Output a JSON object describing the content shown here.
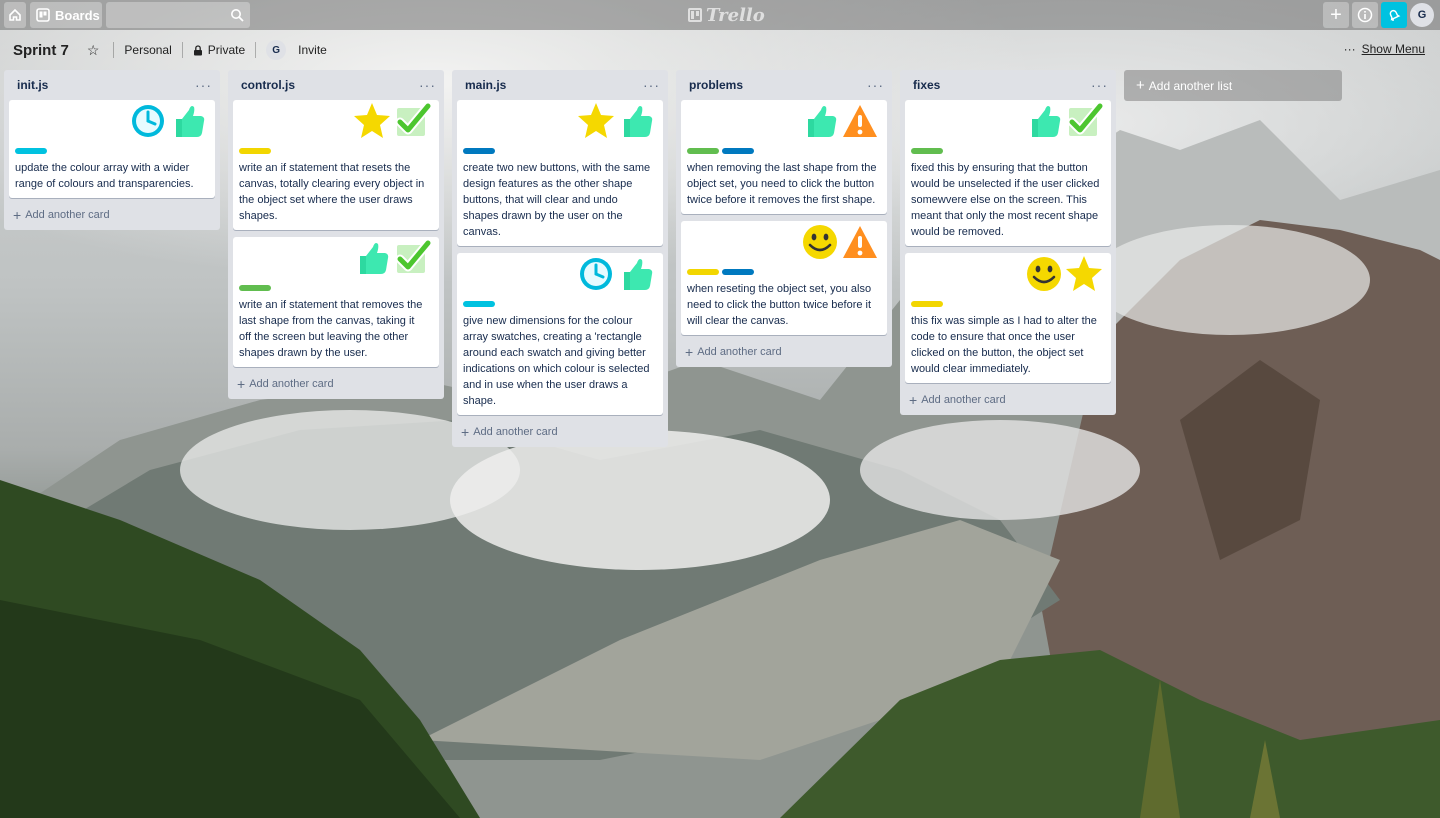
{
  "topbar": {
    "boards_label": "Boards",
    "search_value": "",
    "logo_text": "Trello",
    "avatar_initial": "G",
    "icons": {
      "home": "home-icon",
      "boards": "board-icon",
      "search": "search-icon",
      "add": "plus-icon",
      "info": "info-icon",
      "notifications": "bell-icon"
    }
  },
  "board": {
    "title": "Sprint 7",
    "team": "Personal",
    "visibility": "Private",
    "member_initial": "G",
    "invite": "Invite",
    "show_menu": "Show Menu",
    "add_list": "Add another list",
    "add_card": "Add another card",
    "list_menu": "···"
  },
  "colors": {
    "cyan": "#00c2e0",
    "yellow": "#f2d600",
    "green": "#61bd4f",
    "blue": "#0079bf"
  },
  "lists": [
    {
      "name": "init.js",
      "cards": [
        {
          "stickers": [
            "clock",
            "thumbsup"
          ],
          "labels": [
            "cyan"
          ],
          "text": "update the colour array with a wider range of colours and transparencies."
        }
      ]
    },
    {
      "name": "control.js",
      "cards": [
        {
          "stickers": [
            "star",
            "check"
          ],
          "labels": [
            "yellow"
          ],
          "text": "write an if statement that resets the canvas, totally clearing every object in the object set where the user draws shapes."
        },
        {
          "stickers": [
            "thumbsup",
            "check"
          ],
          "labels": [
            "green"
          ],
          "text": "write an if statement that removes the last shape from the canvas, taking it off the screen but leaving the other shapes drawn by the user."
        }
      ]
    },
    {
      "name": "main.js",
      "cards": [
        {
          "stickers": [
            "star",
            "thumbsup"
          ],
          "labels": [
            "blue"
          ],
          "text": "create two new buttons, with the same design features as the other shape buttons, that will clear and undo shapes drawn by the user on the canvas."
        },
        {
          "stickers": [
            "clock",
            "thumbsup"
          ],
          "labels": [
            "cyan"
          ],
          "text": "give new dimensions for the colour array swatches, creating a 'rectangle around each swatch and giving better indications on which colour is selected and in use when the user draws a shape."
        }
      ]
    },
    {
      "name": "problems",
      "cards": [
        {
          "stickers": [
            "thumbsup",
            "warning"
          ],
          "labels": [
            "green",
            "blue"
          ],
          "text": "when removing the last shape from the object set, you need to click the button twice before it removes the first shape."
        },
        {
          "stickers": [
            "smiley",
            "warning"
          ],
          "labels": [
            "yellow",
            "blue"
          ],
          "text": "when reseting the object set, you also need to click the button twice before it will clear the canvas."
        }
      ]
    },
    {
      "name": "fixes",
      "cards": [
        {
          "stickers": [
            "thumbsup",
            "check"
          ],
          "labels": [
            "green"
          ],
          "text": "fixed this by ensuring that the button would be unselected if the user clicked somewvere else on the screen. This meant that only the most recent shape would be removed."
        },
        {
          "stickers": [
            "smiley",
            "star"
          ],
          "labels": [
            "yellow"
          ],
          "text": "this fix was simple as I had to alter the code to ensure that once the user clicked on the button, the object set would clear immediately."
        }
      ]
    }
  ]
}
